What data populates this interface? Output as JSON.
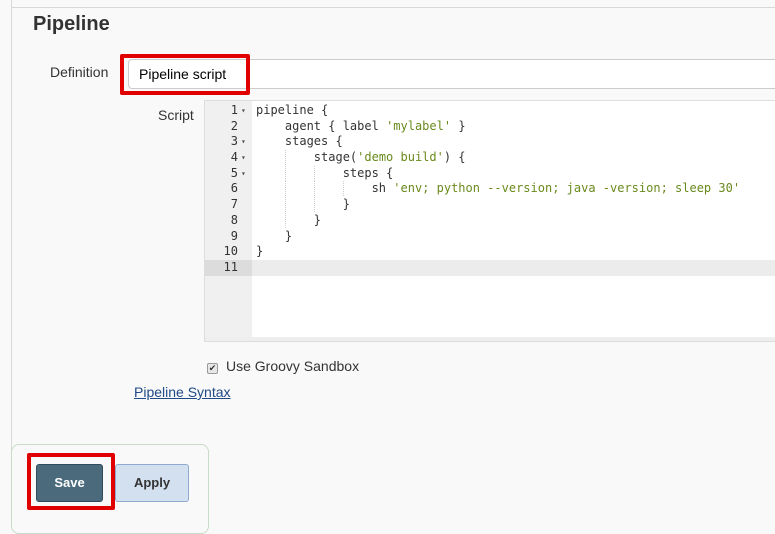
{
  "section": {
    "title": "Pipeline"
  },
  "definition": {
    "label": "Definition",
    "value": "Pipeline script"
  },
  "script": {
    "label": "Script",
    "active_line": 11,
    "lines": [
      {
        "num": "1",
        "fold": true,
        "indent": 0,
        "parts": [
          {
            "t": "pipeline {",
            "s": false
          }
        ]
      },
      {
        "num": "2",
        "fold": false,
        "indent": 1,
        "parts": [
          {
            "t": "agent { label ",
            "s": false
          },
          {
            "t": "'mylabel'",
            "s": true
          },
          {
            "t": " }",
            "s": false
          }
        ]
      },
      {
        "num": "3",
        "fold": true,
        "indent": 1,
        "parts": [
          {
            "t": "stages {",
            "s": false
          }
        ]
      },
      {
        "num": "4",
        "fold": true,
        "indent": 2,
        "parts": [
          {
            "t": "stage(",
            "s": false
          },
          {
            "t": "'demo build'",
            "s": true
          },
          {
            "t": ") {",
            "s": false
          }
        ]
      },
      {
        "num": "5",
        "fold": true,
        "indent": 3,
        "parts": [
          {
            "t": "steps {",
            "s": false
          }
        ]
      },
      {
        "num": "6",
        "fold": false,
        "indent": 4,
        "parts": [
          {
            "t": "sh ",
            "s": false
          },
          {
            "t": "'env; python --version; java -version; sleep 30'",
            "s": true
          }
        ]
      },
      {
        "num": "7",
        "fold": false,
        "indent": 3,
        "parts": [
          {
            "t": "}",
            "s": false
          }
        ]
      },
      {
        "num": "8",
        "fold": false,
        "indent": 2,
        "parts": [
          {
            "t": "}",
            "s": false
          }
        ]
      },
      {
        "num": "9",
        "fold": false,
        "indent": 1,
        "parts": [
          {
            "t": "}",
            "s": false
          }
        ]
      },
      {
        "num": "10",
        "fold": false,
        "indent": 0,
        "parts": [
          {
            "t": "}",
            "s": false
          }
        ]
      },
      {
        "num": "11",
        "fold": false,
        "indent": 0,
        "parts": []
      }
    ]
  },
  "sandbox": {
    "label": "Use Groovy Sandbox",
    "checked": true
  },
  "links": {
    "pipeline_syntax": "Pipeline Syntax"
  },
  "buttons": {
    "save": "Save",
    "apply": "Apply"
  },
  "colors": {
    "highlight": "#e10000",
    "save_bg": "#4b6b7d",
    "apply_bg": "#d3e0f0",
    "string": "#6a8a1d"
  }
}
